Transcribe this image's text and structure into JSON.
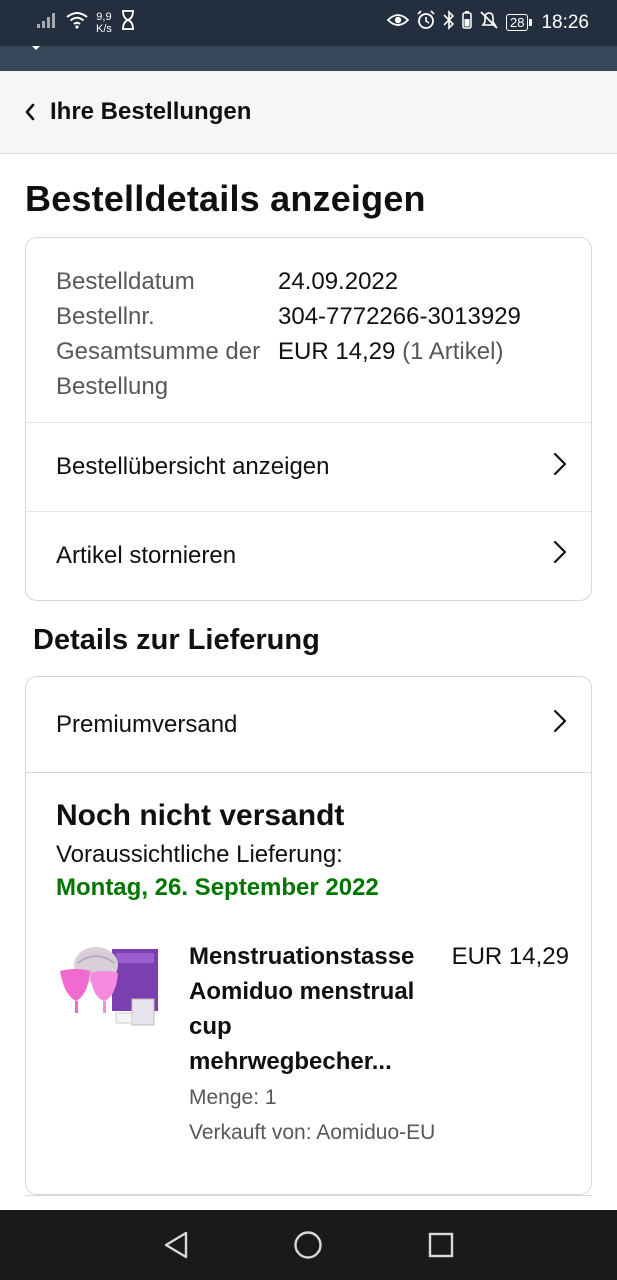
{
  "status_bar": {
    "net_speed_value": "9,9",
    "net_speed_unit": "K/s",
    "battery": "28",
    "time": "18:26"
  },
  "header": {
    "back_label": "Ihre Bestellungen"
  },
  "page_title": "Bestelldetails anzeigen",
  "order_info": {
    "rows": [
      {
        "label": "Bestelldatum",
        "value": "24.09.2022"
      },
      {
        "label": "Bestellnr.",
        "value": "304-7772266-3013929"
      },
      {
        "label": "Gesamtsumme der Bestellung",
        "value": "EUR 14,29",
        "extra": "(1 Artikel)"
      }
    ]
  },
  "order_actions": {
    "view_summary": "Bestellübersicht anzeigen",
    "cancel_items": "Artikel stornieren"
  },
  "delivery": {
    "section_title": "Details zur Lieferung",
    "shipping_method": "Premiumversand",
    "status": "Noch nicht versandt",
    "expected_label": "Voraussichtliche Lieferung:",
    "expected_date": "Montag, 26. September 2022",
    "item": {
      "title": "Menstruationstasse Aomiduo menstrual cup mehrwegbecher...",
      "price": "EUR 14,29",
      "quantity": "Menge: 1",
      "seller": "Verkauft von: Aomiduo-EU"
    }
  },
  "colors": {
    "status_bar": "#232f3e",
    "sub_bar": "#37475a",
    "header_bg": "#f6f6f6",
    "delivery_date": "#007600",
    "border": "#d5d9d9",
    "system_nav": "#1a1a1a"
  },
  "icons": {
    "back": "chevron-left-icon",
    "row": "chevron-right-icon",
    "nav_back": "triangle-back-icon",
    "nav_home": "circle-home-icon",
    "nav_recent": "square-recent-icon"
  }
}
